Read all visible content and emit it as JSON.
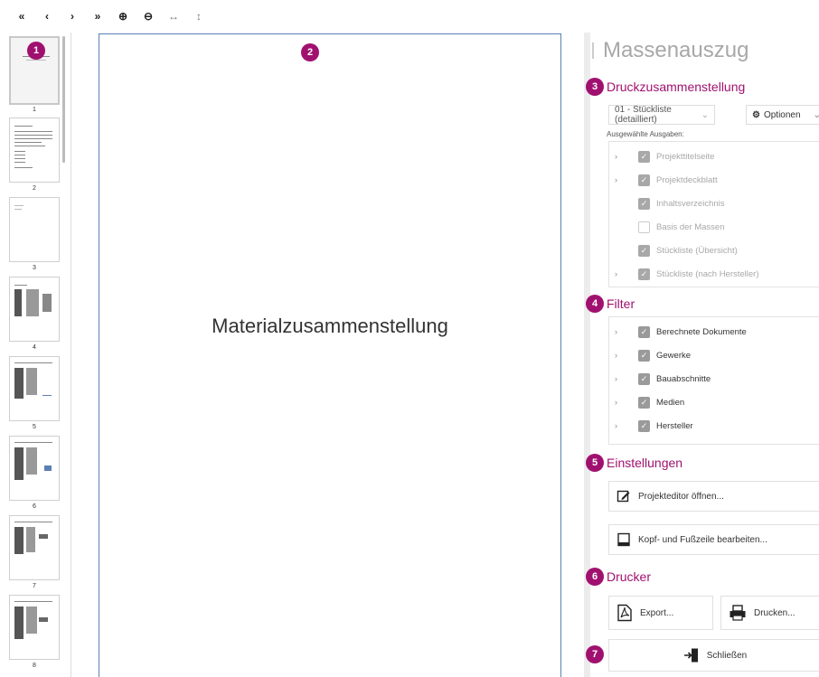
{
  "toolbar": {
    "first_page": "«",
    "prev_page": "‹",
    "next_page": "›",
    "last_page": "»",
    "zoom_in": "⊕",
    "zoom_out": "⊖",
    "fit_width": "↔",
    "fit_height": "↕"
  },
  "thumbnails": {
    "pages": [
      "1",
      "2",
      "3",
      "4",
      "5",
      "6",
      "7",
      "8"
    ]
  },
  "viewer": {
    "page_title": "Materialzusammenstellung"
  },
  "badges": [
    "1",
    "2",
    "3",
    "4",
    "5",
    "6",
    "7"
  ],
  "panel": {
    "title": "Massenauszug",
    "druck": {
      "heading": "Druckzusammenstellung",
      "preset": "01 - Stückliste (detailliert)",
      "options_label": "Optionen",
      "selected_label": "Ausgewählte Ausgaben:",
      "items": [
        {
          "label": "Projekttitelseite",
          "expandable": true,
          "checked": true
        },
        {
          "label": "Projektdeckblatt",
          "expandable": true,
          "checked": true
        },
        {
          "label": "Inhaltsverzeichnis",
          "expandable": false,
          "checked": true
        },
        {
          "label": "Basis der Massen",
          "expandable": false,
          "checked": false
        },
        {
          "label": "Stückliste (Übersicht)",
          "expandable": false,
          "checked": true
        },
        {
          "label": "Stückliste (nach Hersteller)",
          "expandable": true,
          "checked": true
        }
      ]
    },
    "filter": {
      "heading": "Filter",
      "items": [
        {
          "label": "Berechnete Dokumente"
        },
        {
          "label": "Gewerke"
        },
        {
          "label": "Bauabschnitte"
        },
        {
          "label": "Medien"
        },
        {
          "label": "Hersteller"
        }
      ]
    },
    "einstellungen": {
      "heading": "Einstellungen",
      "project_editor": "Projekteditor öffnen...",
      "header_footer": "Kopf- und Fußzeile bearbeiten..."
    },
    "drucker": {
      "heading": "Drucker",
      "export": "Export...",
      "print": "Drucken..."
    },
    "close": "Schließen"
  },
  "colors": {
    "accent": "#a0116f",
    "viewer_border": "#5b7fb5"
  }
}
